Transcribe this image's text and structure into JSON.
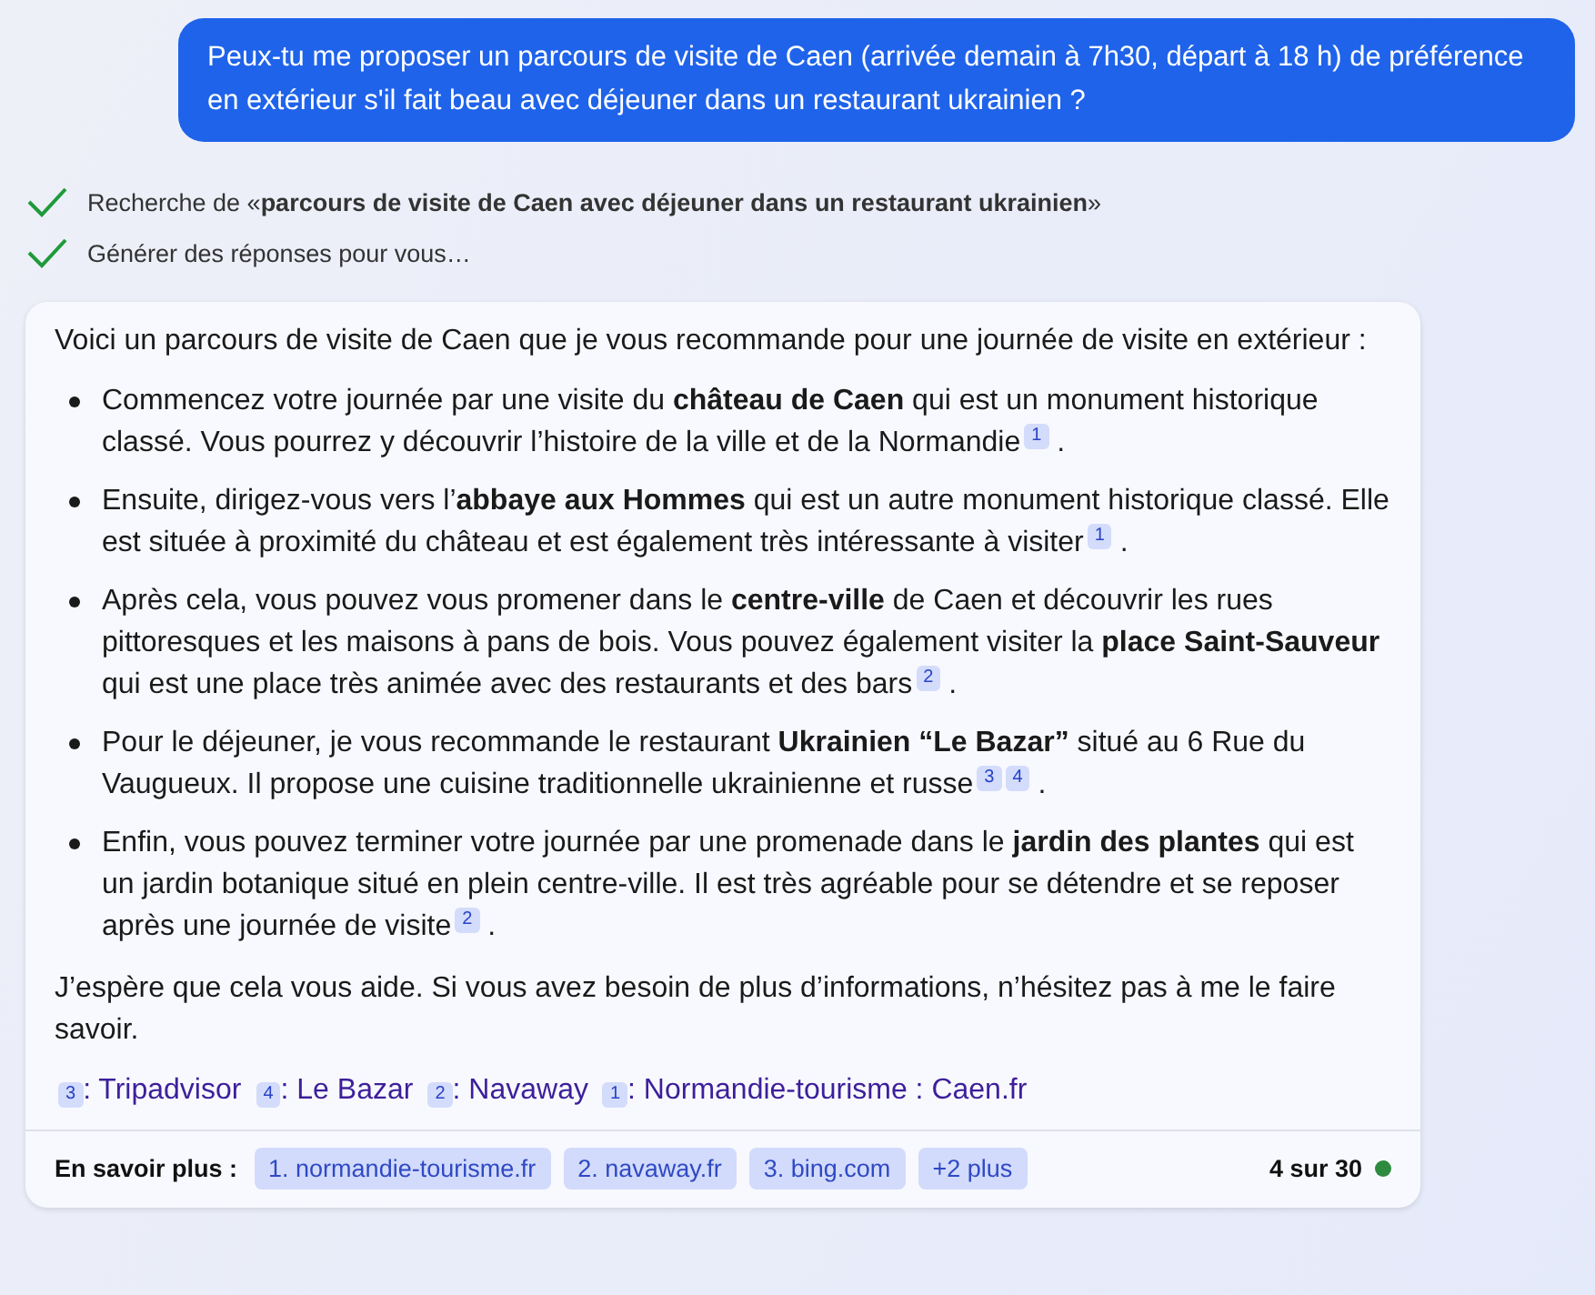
{
  "user_message": "Peux-tu me proposer un parcours de visite de Caen (arrivée demain à 7h30, départ à 18 h) de préférence en extérieur s'il fait beau avec déjeuner dans un restaurant ukrainien ?",
  "progress": [
    {
      "text": "Recherche de «**parcours de visite de Caen avec déjeuner dans un restaurant ukrainien**»",
      "done": true
    },
    {
      "text": "Générer des réponses pour vous…",
      "done": true
    }
  ],
  "answer": {
    "intro": "Voici un parcours de visite de Caen que je vous recommande pour une journée de visite en extérieur :",
    "bullets": [
      {
        "text": "Commencez votre journée par une visite du **château de Caen** qui est un monument historique classé. Vous pourrez y découvrir l’histoire de la ville et de la Normandie",
        "citations": [
          "1"
        ],
        "end": "."
      },
      {
        "text": "Ensuite, dirigez-vous vers l’**abbaye aux Hommes** qui est un autre monument historique classé. Elle est située à proximité du château et est également très intéressante à visiter",
        "citations": [
          "1"
        ],
        "end": "."
      },
      {
        "text": "Après cela, vous pouvez vous promener dans le **centre-ville** de Caen et découvrir les rues pittoresques et les maisons à pans de bois. Vous pouvez également visiter la **place Saint-Sauveur** qui est une place très animée avec des restaurants et des bars",
        "citations": [
          "2"
        ],
        "end": "."
      },
      {
        "text": "Pour le déjeuner, je vous recommande le restaurant **Ukrainien “Le Bazar”** situé au 6 Rue du Vaugueux. Il propose une cuisine traditionnelle ukrainienne et russe",
        "citations": [
          "3",
          "4"
        ],
        "end": "."
      },
      {
        "text": "Enfin, vous pouvez terminer votre journée par une promenade dans le **jardin des plantes** qui est un jardin botanique situé en plein centre-ville. Il est très agréable pour se détendre et se reposer après une journée de visite",
        "citations": [
          "2"
        ],
        "end": "."
      }
    ],
    "closing": "J’espère que cela vous aide. Si vous avez besoin de plus d’informations, n’hésitez pas à me le faire savoir.",
    "sources": [
      {
        "number": "3",
        "label": ": Tripadvisor"
      },
      {
        "number": "4",
        "label": ": Le Bazar"
      },
      {
        "number": "2",
        "label": ": Navaway"
      },
      {
        "number": "1",
        "label": ": Normandie-tourisme : Caen.fr"
      }
    ]
  },
  "footer": {
    "label": "En savoir plus :",
    "links": [
      "1. normandie-tourisme.fr",
      "2. navaway.fr",
      "3. bing.com",
      "+2 plus"
    ],
    "count": "4 sur 30"
  }
}
